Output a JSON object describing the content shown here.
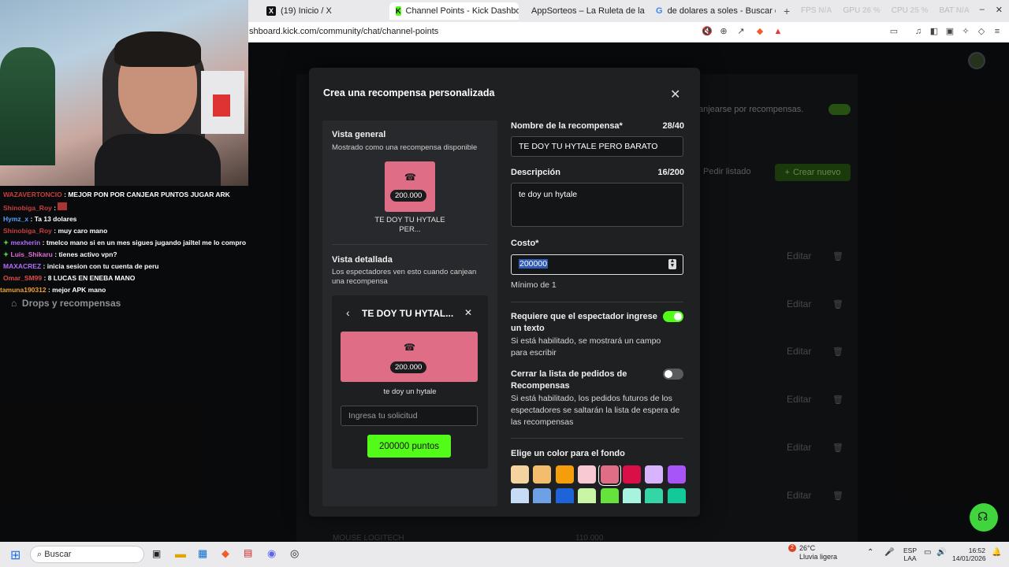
{
  "browser": {
    "tabs": [
      {
        "label": "(19) Inicio / X",
        "icon": "x-icon"
      },
      {
        "label": "Channel Points - Kick Dashboard",
        "icon": "kick-icon",
        "active": true
      },
      {
        "label": "AppSorteos – La Ruleta de la Suerte",
        "icon": "appsorteos-icon"
      },
      {
        "label": "de dolares a soles - Buscar con Goog",
        "icon": "google-icon"
      }
    ],
    "new_tab": "+",
    "url": "shboard.kick.com/community/chat/channel-points",
    "perf": {
      "fps_label": "FPS",
      "fps_value": "N/A",
      "gpu_label": "GPU",
      "gpu_value": "26 %",
      "cpu_label": "CPU",
      "cpu_value": "25 %",
      "bat_label": "BAT",
      "bat_value": "N/A"
    }
  },
  "background_page": {
    "toggle_text": "anjearse por recompensas.",
    "pedir": "Pedir listado",
    "crear": "Crear nuevo",
    "edit_label": "Editar",
    "bottom_item": "MOUSE LOGITECH",
    "bottom_value": "110.000"
  },
  "modal": {
    "title": "Crea una recompensa personalizada",
    "preview": {
      "general_title": "Vista general",
      "general_sub": "Mostrado como una recompensa disponible",
      "card_points": "200.000",
      "card_title": "TE DOY TU HYTALE PER...",
      "detail_title": "Vista detallada",
      "detail_sub": "Los espectadores ven esto cuando canjean una recompensa",
      "detail_header": "TE DOY TU HYTAL...",
      "detail_points": "200.000",
      "detail_desc": "te doy un hytale",
      "input_placeholder": "Ingresa tu solicitud",
      "redeem_button": "200000 puntos"
    },
    "form": {
      "name_label": "Nombre de la recompensa*",
      "name_count": "28/40",
      "name_value": "TE DOY TU HYTALE PERO BARATO",
      "desc_label": "Descripción",
      "desc_count": "16/200",
      "desc_value": "te doy un hytale",
      "cost_label": "Costo*",
      "cost_value": "200000",
      "cost_min": "Mínimo de 1",
      "require_text_label": "Requiere que el espectador ingrese un texto",
      "require_text_help": "Si está habilitado, se mostrará un campo para escribir",
      "require_text_on": true,
      "skip_queue_label": "Cerrar la lista de pedidos de Recompensas",
      "skip_queue_help": "Si está habilitado, los pedidos futuros de los espectadores se saltarán la lista de espera de las recompensas",
      "skip_queue_on": false,
      "color_label": "Elige un color para el fondo",
      "colors_row1": [
        "#f5d3a0",
        "#f2be6e",
        "#f59e0b",
        "#f6c9d3",
        "#df6d86",
        "#d91048",
        "#d8b4fe",
        "#a855f7"
      ],
      "colors_row2": [
        "#c6dbf5",
        "#6ea0e6",
        "#1d64d8",
        "#c8f5a6",
        "#65e23b",
        "#a7f3e0",
        "#34d6a8",
        "#12c99a"
      ],
      "selected_color": "#df6d86"
    }
  },
  "chat": [
    {
      "user": "WAZAVERTONCIO",
      "color": "#d23b3b",
      "text": ": MEJOR PON POR CANJEAR PUNTOS JUGAR ARK"
    },
    {
      "user": "Shinobiga_Roy",
      "color": "#d23b3b",
      "text": ":"
    },
    {
      "user": "Hymz_x",
      "color": "#5aa0ff",
      "text": ": Ta 13 dolares"
    },
    {
      "user": "Shinobiga_Roy",
      "color": "#d23b3b",
      "text": ": muy caro mano"
    },
    {
      "user": "mexherin",
      "color": "#b36cff",
      "text": ": tmelco mano si en un mes sigues jugando jailtel me lo compro"
    },
    {
      "user": "Luis_Shikaru",
      "color": "#e06bd6",
      "text": ": tienes activo vpn?"
    },
    {
      "user": "MAXACREZ",
      "color": "#b36cff",
      "text": ": inicia sesion con tu cuenta de peru"
    },
    {
      "user": "Omar_SM99",
      "color": "#e04c4c",
      "text": ": 8 LUCAS EN ENEBA MANO"
    },
    {
      "user": "tamuna190312",
      "color": "#f0a030",
      "text": ": mejor APK mano"
    }
  ],
  "sidebar": {
    "drops": "Drops y recompensas"
  },
  "taskbar": {
    "search": "Buscar",
    "weather_temp": "26°C",
    "weather_desc": "Lluvia ligera",
    "lang1": "ESP",
    "lang2": "LAA",
    "time": "16:52",
    "date": "14/01/2026",
    "notif_count": "2"
  }
}
